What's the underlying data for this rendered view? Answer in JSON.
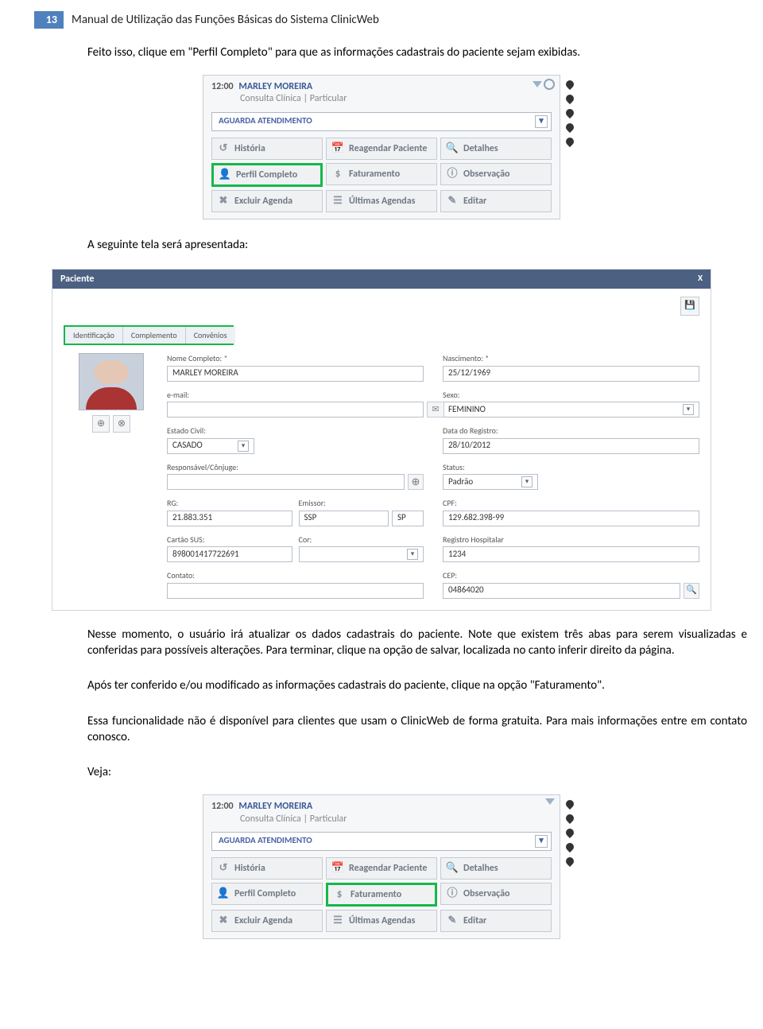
{
  "header": {
    "pageNumber": "13",
    "docTitle": "Manual de Utilização das Funções Básicas do Sistema ClinicWeb"
  },
  "paragraphs": {
    "p1": "Feito isso, clique em \"Perfil Completo\" para que as informações cadastrais do paciente sejam exibidas.",
    "p2": "A seguinte tela será apresentada:",
    "p3": "Nesse momento, o usuário irá atualizar os dados cadastrais do paciente. Note que existem três abas para serem visualizadas e conferidas para possíveis alterações. Para terminar, clique na opção de salvar, localizada no canto inferir direito da página.",
    "p4": "Após ter conferido e/ou modificado as informações cadastrais do paciente, clique na opção \"Faturamento\".",
    "p5": "Essa funcionalidade não é disponível para clientes que usam o ClinicWeb de forma gratuita. Para mais informações entre em contato conosco.",
    "p6": "Veja:"
  },
  "agenda": {
    "time": "12:00",
    "patientName": "MARLEY MOREIRA",
    "subtitle": "Consulta Clínica | Particular",
    "statusSelect": "AGUARDA ATENDIMENTO",
    "buttons": {
      "historia": "História",
      "reagendar": "Reagendar Paciente",
      "detalhes": "Detalhes",
      "perfil": "Perfil Completo",
      "faturamento": "Faturamento",
      "observacao": "Observação",
      "excluir": "Excluir Agenda",
      "ultimas": "Últimas Agendas",
      "editar": "Editar"
    }
  },
  "patientForm": {
    "title": "Paciente",
    "close": "X",
    "tabs": {
      "identificacao": "Identificação",
      "complemento": "Complemento",
      "convenios": "Convênios"
    },
    "labels": {
      "nome": "Nome Completo: *",
      "nascimento": "Nascimento: *",
      "email": "e-mail:",
      "sexo": "Sexo:",
      "estadoCivil": "Estado Civil:",
      "dataRegistro": "Data do Registro:",
      "responsavel": "Responsável/Cônjuge:",
      "status": "Status:",
      "rg": "RG:",
      "emissor": "Emissor:",
      "cpf": "CPF:",
      "sus": "Cartão SUS:",
      "cor": "Cor:",
      "regHosp": "Registro Hospitalar",
      "contato": "Contato:",
      "cep": "CEP:"
    },
    "values": {
      "nome": "MARLEY MOREIRA",
      "nascimento": "25/12/1969",
      "email": "",
      "sexo": "FEMININO",
      "estadoCivil": "CASADO",
      "dataRegistro": "28/10/2012",
      "responsavel": "",
      "status": "Padrão",
      "rg": "21.883.351",
      "emissor1": "SSP",
      "emissor2": "SP",
      "cpf": "129.682.398-99",
      "sus": "898001417722691",
      "cor": "",
      "regHosp": "1234",
      "contato": "",
      "cep": "04864020"
    }
  }
}
